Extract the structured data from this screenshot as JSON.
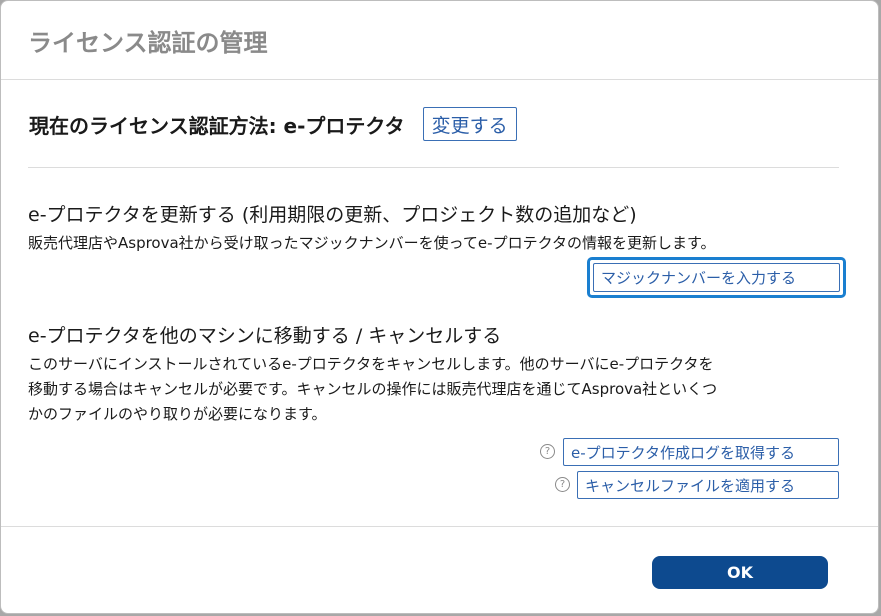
{
  "dialog": {
    "title": "ライセンス認証の管理"
  },
  "current": {
    "label": "現在のライセンス認証方法: e-プロテクタ",
    "change_button": "変更する"
  },
  "update_section": {
    "heading": "e-プロテクタを更新する (利用期限の更新、プロジェクト数の追加など)",
    "description": "販売代理店やAsprova社から受け取ったマジックナンバーを使ってe-プロテクタの情報を更新します。",
    "button": "マジックナンバーを入力する"
  },
  "move_section": {
    "heading": "e-プロテクタを他のマシンに移動する / キャンセルする",
    "description_line1": "このサーバにインストールされているe-プロテクタをキャンセルします。他のサーバにe-プロテクタを",
    "description_line2": "移動する場合はキャンセルが必要です。キャンセルの操作には販売代理店を通じてAsprova社といくつ",
    "description_line3": "かのファイルのやり取りが必要になります。",
    "log_button": "e-プロテクタ作成ログを取得する",
    "cancel_file_button": "キャンセルファイルを適用する",
    "help_icon_glyph": "?"
  },
  "footer": {
    "ok_button": "OK"
  },
  "colors": {
    "accent": "#0d4a8f",
    "link": "#2b5ea8",
    "focus": "#1a7fd0",
    "title_gray": "#8a8a8a"
  }
}
